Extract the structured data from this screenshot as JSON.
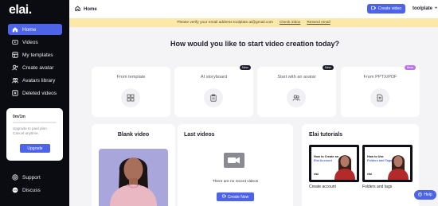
{
  "app": {
    "logo": "elai."
  },
  "sidebar": {
    "items": [
      {
        "label": "Home",
        "icon": "home-icon",
        "active": true
      },
      {
        "label": "Videos",
        "icon": "video-icon"
      },
      {
        "label": "My templates",
        "icon": "templates-icon"
      },
      {
        "label": "Create avatar",
        "icon": "add-avatar-icon"
      },
      {
        "label": "Avatars library",
        "icon": "avatars-library-icon"
      },
      {
        "label": "Deleted videos",
        "icon": "trash-icon"
      }
    ],
    "plan": {
      "used": "0m/1m",
      "usage_fraction": 0,
      "text": "Upgrade to paid plan. Cancel anytime.",
      "upgrade_label": "Upgrade"
    },
    "bottom_items": [
      {
        "label": "Support",
        "icon": "support-icon"
      },
      {
        "label": "Discuss",
        "icon": "discord-icon"
      }
    ]
  },
  "header": {
    "title": "Home",
    "create_video_label": "Create video",
    "user_name": "toolplate"
  },
  "banner": {
    "message": "Please verify your email address toolplate.ai@gmail.com",
    "check_inbox": "Check inbox",
    "resend_email": "Resend email"
  },
  "main": {
    "heading": "How would you like to start video creation today?",
    "options": [
      {
        "label": "From template",
        "icon": "grid-icon",
        "badge": ""
      },
      {
        "label": "AI storyboard",
        "icon": "clipboard-icon",
        "badge": "New"
      },
      {
        "label": "Start with an avatar",
        "icon": "users-icon",
        "badge": "New"
      },
      {
        "label": "From PPTX/PDF",
        "icon": "file-upload-icon",
        "badge": "Beta"
      }
    ],
    "blank_video": {
      "title": "Blank video"
    },
    "last_videos": {
      "title": "Last videos",
      "empty_text": "There are no recent videos",
      "create_now_label": "Create Now"
    },
    "tutorials": {
      "title": "Elai tutorials",
      "items": [
        {
          "caption_line1": "How to Create an",
          "caption_line2": "Elai Account",
          "brand": "elai",
          "label": "Create account"
        },
        {
          "caption_line1": "How to Use",
          "caption_line2": "Folders and Tags",
          "brand": "elai",
          "label": "Folders and tags"
        }
      ]
    }
  },
  "help": {
    "label": "Help"
  },
  "colors": {
    "accent": "#4d63e8",
    "sidebar_bg": "#0b0b12",
    "banner_bg": "#fce8a8",
    "avatar_bg": "#a9a6db",
    "beta_badge": "#b872e8"
  }
}
